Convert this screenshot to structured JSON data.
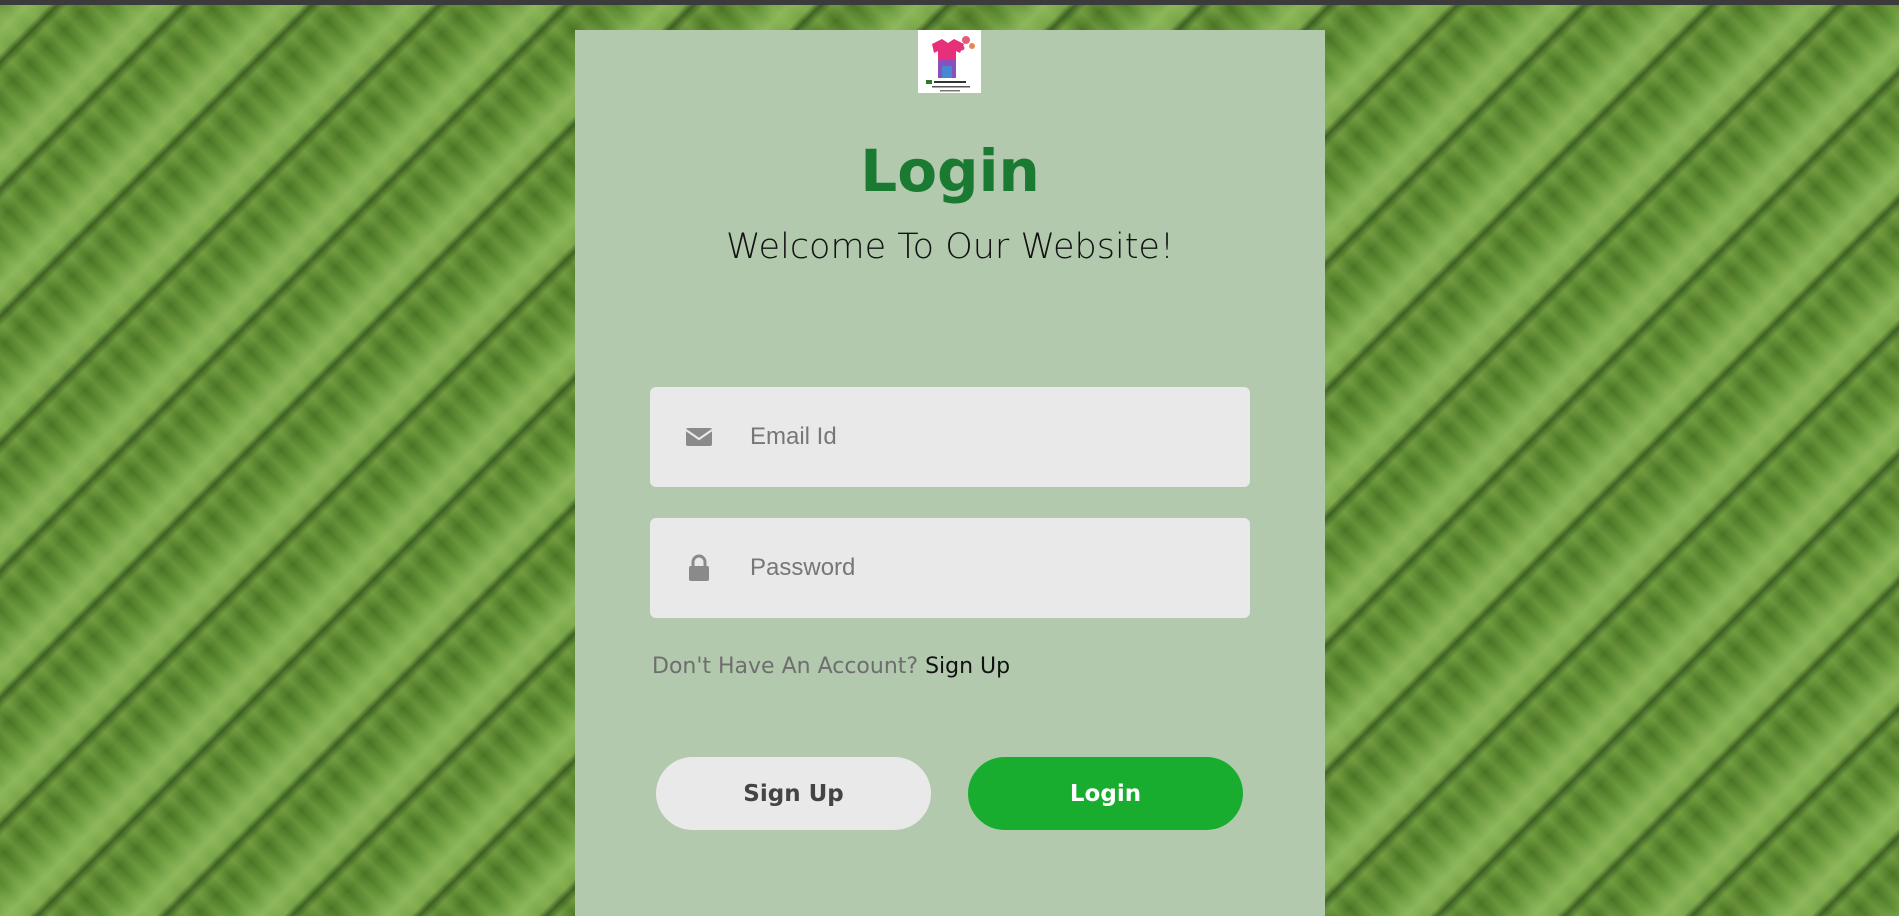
{
  "login_card": {
    "title": "Login",
    "subtitle": "Welcome To Our Website!",
    "email_field": {
      "placeholder": "Email Id",
      "value": "",
      "icon": "envelope-icon"
    },
    "password_field": {
      "placeholder": "Password",
      "value": "",
      "icon": "lock-icon"
    },
    "account_prompt": {
      "text": "Don't Have An Account?",
      "link_label": "Sign Up"
    },
    "buttons": {
      "signup_label": "Sign Up",
      "login_label": "Login"
    }
  },
  "colors": {
    "panel_background": "#b2c9ae",
    "title_color": "#1b7a32",
    "login_button": "#18ad2e",
    "signup_button": "#e9e9e9",
    "field_background": "#e9e9e9"
  }
}
